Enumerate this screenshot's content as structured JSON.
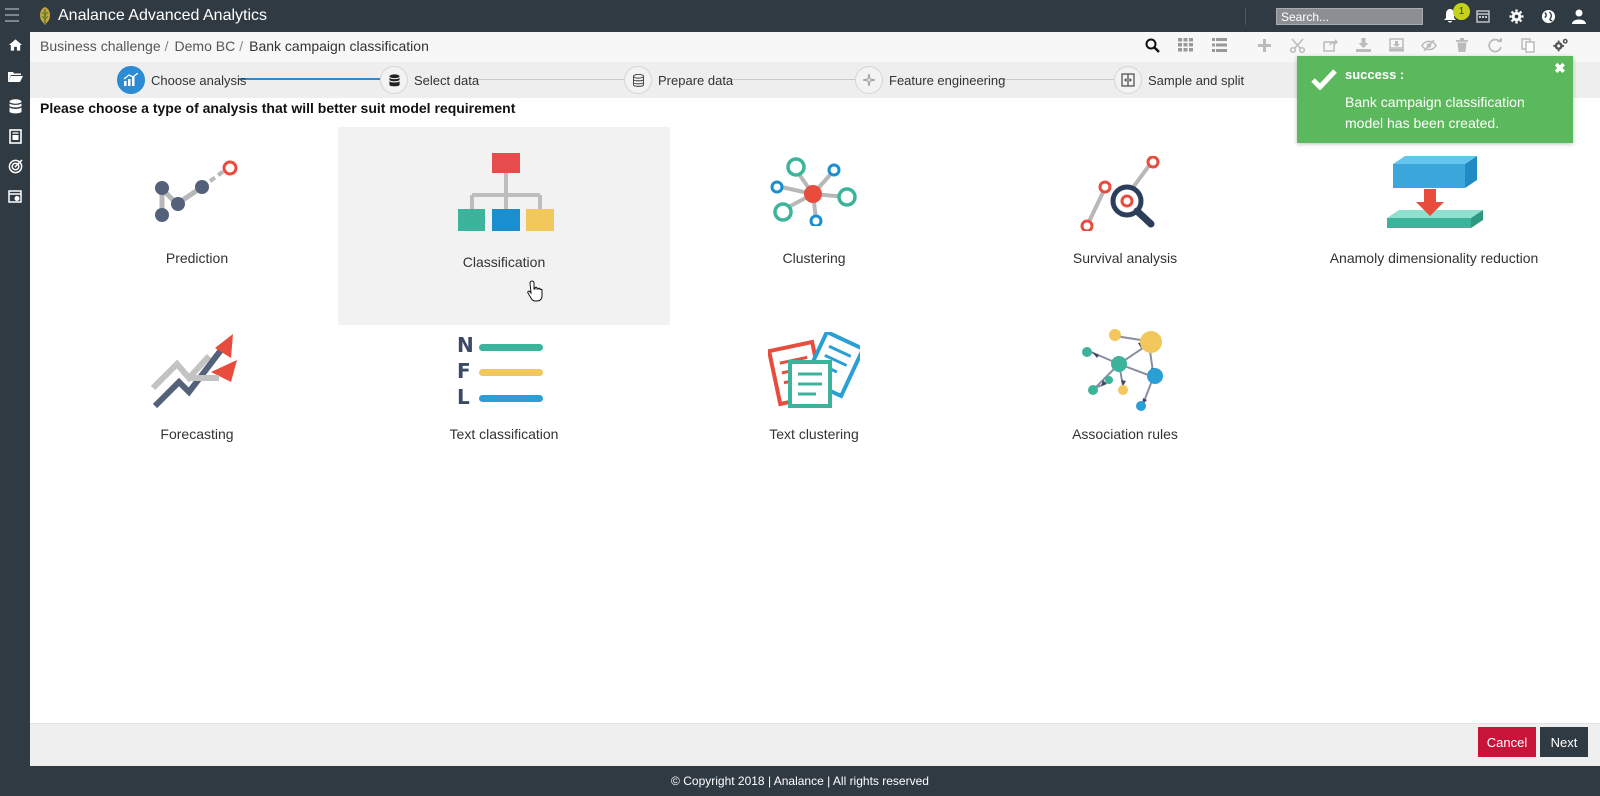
{
  "app": {
    "title": "Analance Advanced Analytics"
  },
  "search": {
    "placeholder": "Search..."
  },
  "notifications": {
    "count": "1"
  },
  "breadcrumb": {
    "items": [
      "Business challenge",
      "Demo BC",
      "Bank campaign classification"
    ],
    "separator": "/"
  },
  "stepper": {
    "steps": [
      {
        "label": "Choose analysis",
        "active": true
      },
      {
        "label": "Select data",
        "active": false
      },
      {
        "label": "Prepare data",
        "active": false
      },
      {
        "label": "Feature engineering",
        "active": false
      },
      {
        "label": "Sample and split",
        "active": false
      }
    ]
  },
  "instruction": "Please choose a type of analysis that will better suit model requirement",
  "analyses": {
    "row1": [
      {
        "label": "Prediction",
        "icon": "prediction-icon"
      },
      {
        "label": "Classification",
        "icon": "classification-icon"
      },
      {
        "label": "Clustering",
        "icon": "clustering-icon"
      },
      {
        "label": "Survival analysis",
        "icon": "survival-icon"
      },
      {
        "label": "Anamoly dimensionality reduction",
        "icon": "anomaly-icon"
      }
    ],
    "row2": [
      {
        "label": "Forecasting",
        "icon": "forecasting-icon"
      },
      {
        "label": "Text classification",
        "icon": "text-classification-icon"
      },
      {
        "label": "Text clustering",
        "icon": "text-clustering-icon"
      },
      {
        "label": "Association rules",
        "icon": "association-rules-icon"
      }
    ]
  },
  "toast": {
    "title": "success :",
    "message": "Bank campaign classification model has been created."
  },
  "actions": {
    "cancel": "Cancel",
    "next": "Next"
  },
  "footer": {
    "text": "© Copyright 2018 | Analance | All rights reserved"
  },
  "colors": {
    "topbar": "#2f3a43",
    "accent": "#2b8bd3",
    "success": "#5cb85c",
    "cancel": "#c9143a"
  }
}
